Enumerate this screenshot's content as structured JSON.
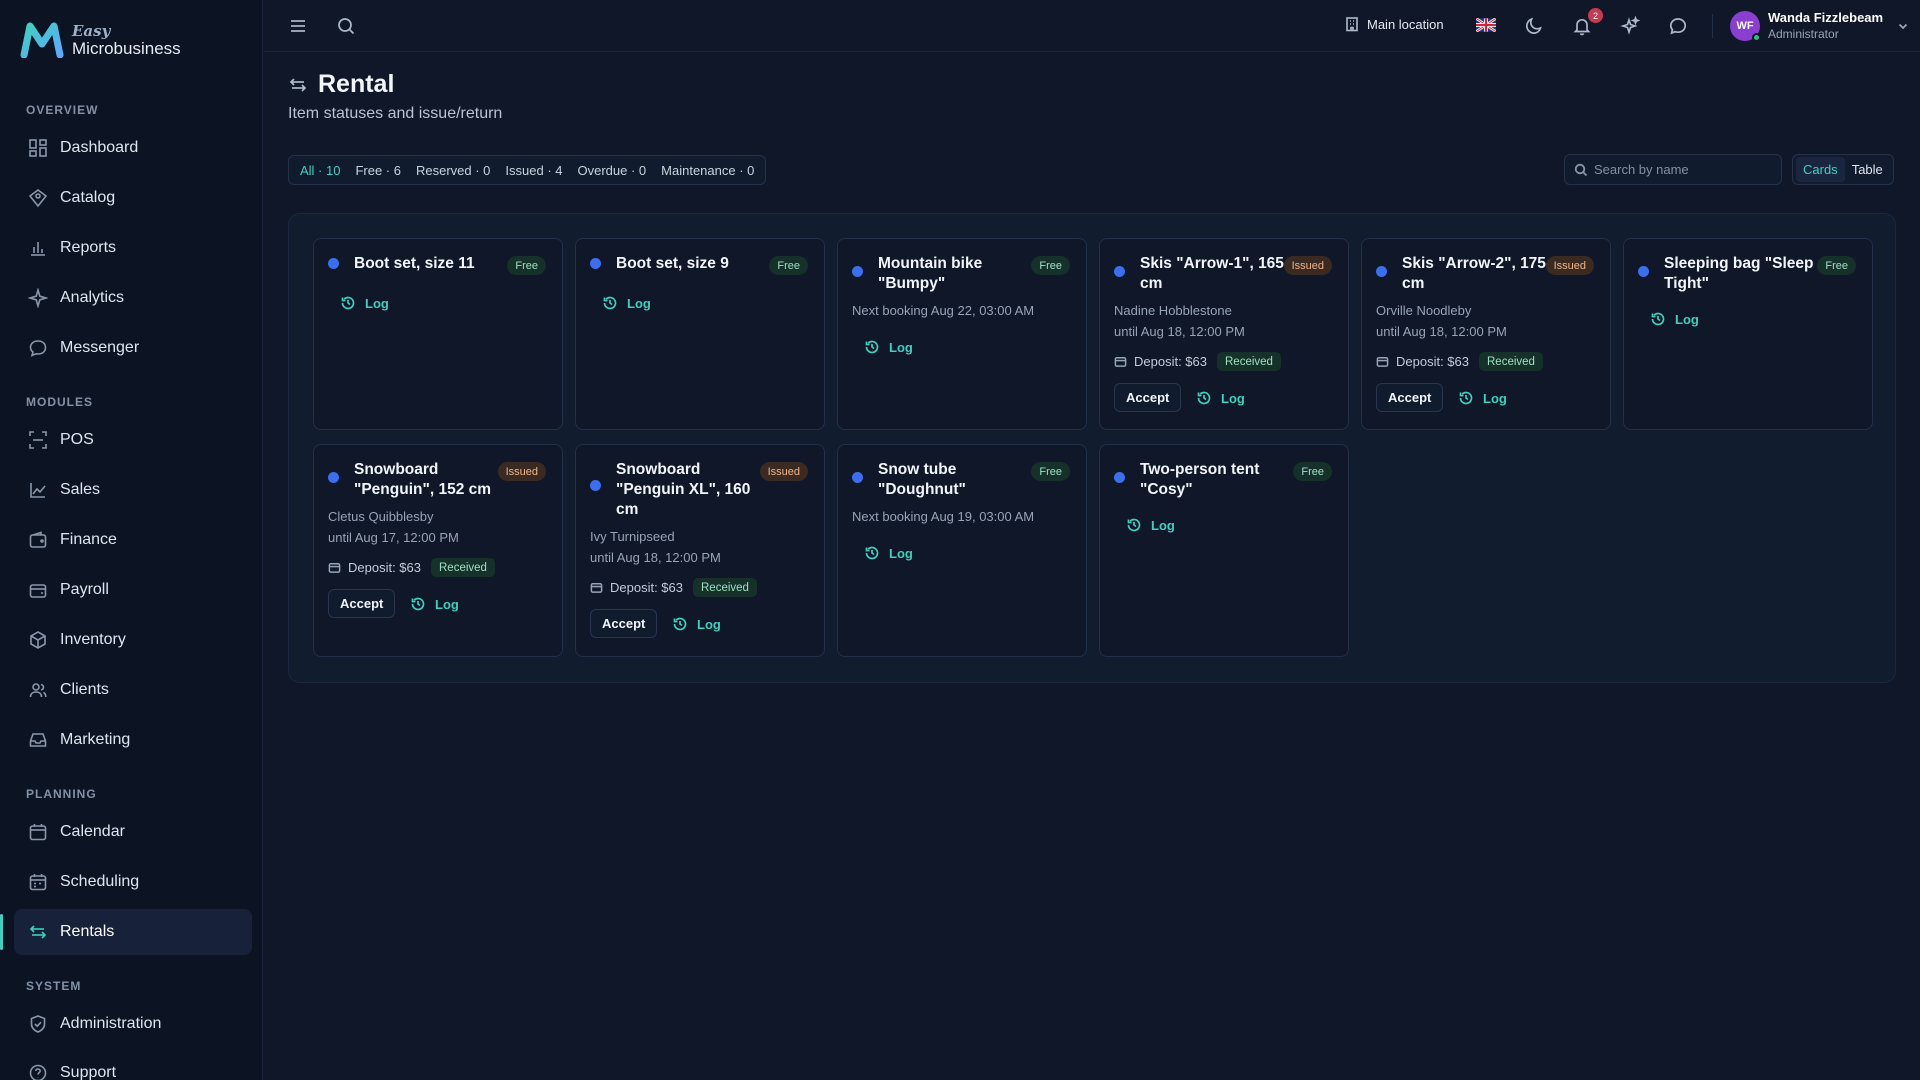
{
  "brand": {
    "line1": "Easy",
    "line2": "Microbusiness"
  },
  "sidebar": {
    "sections": [
      {
        "title": "OVERVIEW",
        "items": [
          "Dashboard",
          "Catalog",
          "Reports",
          "Analytics",
          "Messenger"
        ]
      },
      {
        "title": "MODULES",
        "items": [
          "POS",
          "Sales",
          "Finance",
          "Payroll",
          "Inventory",
          "Clients",
          "Marketing"
        ]
      },
      {
        "title": "PLANNING",
        "items": [
          "Calendar",
          "Scheduling",
          "Rentals"
        ]
      },
      {
        "title": "SYSTEM",
        "items": [
          "Administration",
          "Support"
        ]
      }
    ],
    "active_item": "Rentals"
  },
  "topbar": {
    "location": "Main location",
    "notifications_count": "2",
    "user": {
      "initials": "WF",
      "name": "Wanda Fizzlebeam",
      "role": "Administrator"
    }
  },
  "page": {
    "title": "Rental",
    "subtitle": "Item statuses and issue/return"
  },
  "filters": [
    "All · 10",
    "Free · 6",
    "Reserved · 0",
    "Issued · 4",
    "Overdue · 0",
    "Maintenance · 0"
  ],
  "search": {
    "placeholder": "Search by name"
  },
  "view_toggle": {
    "cards": "Cards",
    "table": "Table",
    "active": "Cards"
  },
  "colors": {
    "accent": "#3fd0bf",
    "status_dot": "#3b6ff0",
    "free_badge": "#9be0c0",
    "issued_badge": "#f0b48a"
  },
  "labels": {
    "log": "Log",
    "accept": "Accept",
    "received": "Received"
  },
  "cards": [
    {
      "title": "Boot set, size 11",
      "status": "Free"
    },
    {
      "title": "Boot set, size 9",
      "status": "Free"
    },
    {
      "title": "Mountain bike \"Bumpy\"",
      "status": "Free",
      "note": "Next booking Aug 22, 03:00 AM"
    },
    {
      "title": "Skis \"Arrow-1\", 165 cm",
      "status": "Issued",
      "client": "Nadine Hobblestone",
      "until": "until Aug 18, 12:00 PM",
      "deposit": "Deposit: $63"
    },
    {
      "title": "Skis \"Arrow-2\", 175 cm",
      "status": "Issued",
      "client": "Orville Noodleby",
      "until": "until Aug 18, 12:00 PM",
      "deposit": "Deposit: $63"
    },
    {
      "title": "Sleeping bag \"Sleep Tight\"",
      "status": "Free"
    },
    {
      "title": "Snowboard \"Penguin\", 152 cm",
      "status": "Issued",
      "client": "Cletus Quibblesby",
      "until": "until Aug 17, 12:00 PM",
      "deposit": "Deposit: $63"
    },
    {
      "title": "Snowboard \"Penguin XL\", 160 cm",
      "status": "Issued",
      "client": "Ivy Turnipseed",
      "until": "until Aug 18, 12:00 PM",
      "deposit": "Deposit: $63"
    },
    {
      "title": "Snow tube \"Doughnut\"",
      "status": "Free",
      "note": "Next booking Aug 19, 03:00 AM"
    },
    {
      "title": "Two-person tent \"Cosy\"",
      "status": "Free"
    }
  ]
}
